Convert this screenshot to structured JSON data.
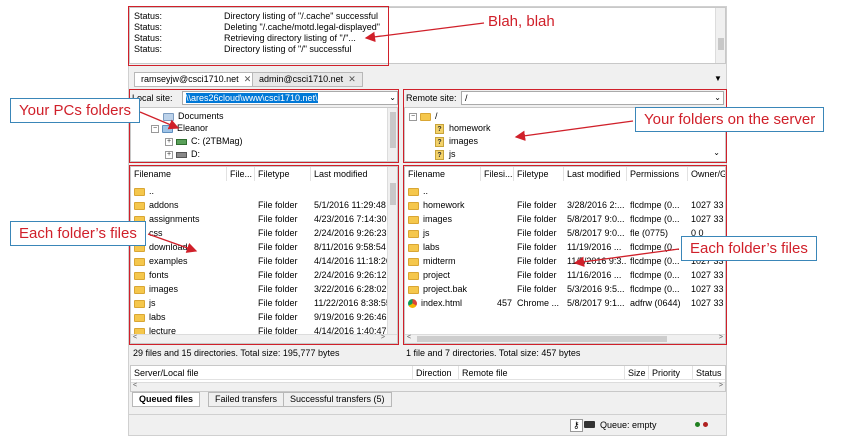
{
  "log": {
    "lines": [
      {
        "label": "Status:",
        "text": "Directory listing of \"/.cache\" successful"
      },
      {
        "label": "Status:",
        "text": "Deleting \"/.cache/motd.legal-displayed\""
      },
      {
        "label": "Status:",
        "text": "Retrieving directory listing of \"/\"..."
      },
      {
        "label": "Status:",
        "text": "Directory listing of \"/\" successful"
      }
    ]
  },
  "tabs": [
    {
      "label": "ramseyjw@csci1710.net"
    },
    {
      "label": "admin@csci1710.net"
    }
  ],
  "local_site": {
    "label": "Local site:",
    "path": "\\\\ares26cloud\\www\\csci1710.net\\",
    "tree": [
      {
        "label": "Documents"
      },
      {
        "label": "Eleanor"
      },
      {
        "label": "C: (2TBMag)"
      },
      {
        "label": "D:"
      }
    ]
  },
  "remote_site": {
    "label": "Remote site:",
    "path": "/",
    "tree": [
      {
        "label": "/"
      },
      {
        "label": "homework"
      },
      {
        "label": "images"
      },
      {
        "label": "js"
      }
    ]
  },
  "local_list": {
    "headers": [
      "Filename",
      "File...",
      "Filetype",
      "Last modified"
    ],
    "rows": [
      {
        "name": "..",
        "size": "",
        "type": "",
        "modified": ""
      },
      {
        "name": "addons",
        "size": "",
        "type": "File folder",
        "modified": "5/1/2016 11:29:48 ..."
      },
      {
        "name": "assignments",
        "size": "",
        "type": "File folder",
        "modified": "4/23/2016 7:14:30 ..."
      },
      {
        "name": "css",
        "size": "",
        "type": "File folder",
        "modified": "2/24/2016 9:26:23 ..."
      },
      {
        "name": "downloads",
        "size": "",
        "type": "File folder",
        "modified": "8/11/2016 9:58:54 ..."
      },
      {
        "name": "examples",
        "size": "",
        "type": "File folder",
        "modified": "4/14/2016 11:18:26..."
      },
      {
        "name": "fonts",
        "size": "",
        "type": "File folder",
        "modified": "2/24/2016 9:26:12 ..."
      },
      {
        "name": "images",
        "size": "",
        "type": "File folder",
        "modified": "3/22/2016 6:28:02 ..."
      },
      {
        "name": "js",
        "size": "",
        "type": "File folder",
        "modified": "11/22/2016 8:38:55..."
      },
      {
        "name": "labs",
        "size": "",
        "type": "File folder",
        "modified": "9/19/2016 9:26:46 ..."
      },
      {
        "name": "lecture",
        "size": "",
        "type": "File folder",
        "modified": "4/14/2016 1:40:47 ..."
      }
    ]
  },
  "remote_list": {
    "headers": [
      "Filename",
      "Filesi...",
      "Filetype",
      "Last modified",
      "Permissions",
      "Owner/G"
    ],
    "rows": [
      {
        "name": "..",
        "size": "",
        "type": "",
        "modified": "",
        "perm": "",
        "owner": ""
      },
      {
        "name": "homework",
        "size": "",
        "type": "File folder",
        "modified": "3/28/2016 2:...",
        "perm": "flcdmpe (0...",
        "owner": "1027 33"
      },
      {
        "name": "images",
        "size": "",
        "type": "File folder",
        "modified": "5/8/2017 9:0...",
        "perm": "flcdmpe (0...",
        "owner": "1027 33"
      },
      {
        "name": "js",
        "size": "",
        "type": "File folder",
        "modified": "5/8/2017 9:0...",
        "perm": "fle (0775)",
        "owner": "0 0"
      },
      {
        "name": "labs",
        "size": "",
        "type": "File folder",
        "modified": "11/19/2016 ...",
        "perm": "flcdmpe (0...",
        "owner": "1027 33"
      },
      {
        "name": "midterm",
        "size": "",
        "type": "File folder",
        "modified": "11/5/2016 9:3...",
        "perm": "flcdmpe (0...",
        "owner": "1027 33"
      },
      {
        "name": "project",
        "size": "",
        "type": "File folder",
        "modified": "11/16/2016 ...",
        "perm": "flcdmpe (0...",
        "owner": "1027 33"
      },
      {
        "name": "project.bak",
        "size": "",
        "type": "File folder",
        "modified": "5/3/2016 9:5...",
        "perm": "flcdmpe (0...",
        "owner": "1027 33"
      },
      {
        "name": "index.html",
        "size": "457",
        "type": "Chrome ...",
        "modified": "5/8/2017 9:1...",
        "perm": "adfrw (0644)",
        "owner": "1027 33"
      }
    ]
  },
  "local_status": "29 files and 15 directories. Total size: 195,777 bytes",
  "remote_status": "1 file and 7 directories. Total size: 457 bytes",
  "queue": {
    "headers": [
      "Server/Local file",
      "Direction",
      "Remote file",
      "Size",
      "Priority",
      "Status"
    ],
    "tabs": [
      "Queued files",
      "Failed transfers",
      "Successful transfers (5)"
    ],
    "status": "Queue: empty"
  },
  "annotations": {
    "blah": "Blah, blah",
    "pc_folders": "Your PCs folders",
    "server_folders": "Your folders on the server",
    "each_left": "Each folder’s files",
    "each_right": "Each folder’s files"
  },
  "colors": {
    "annotation_red": "#d0202a",
    "callout_border": "#3a86b8",
    "selection_blue": "#0078d7",
    "folder_yellow": "#f5c74c"
  }
}
